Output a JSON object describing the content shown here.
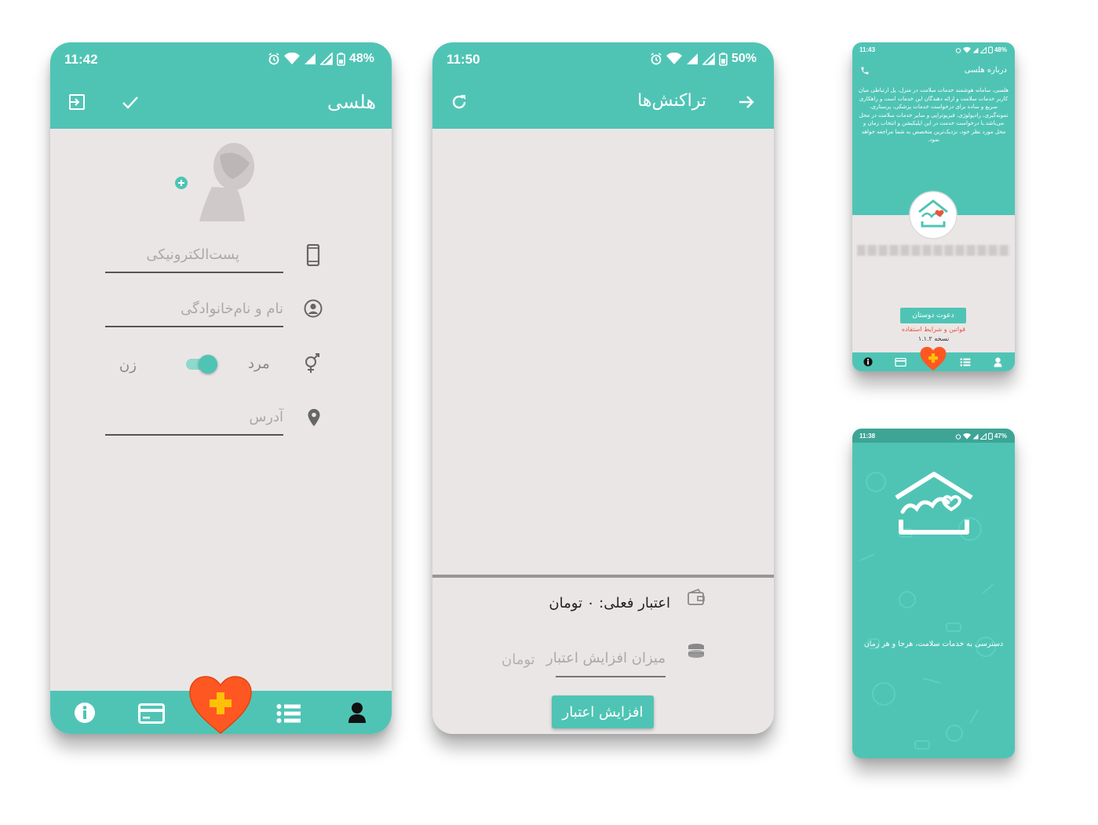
{
  "colors": {
    "primary": "#4fc4b5",
    "primary_dark": "#3ea596",
    "background": "#ebe6e6",
    "heart": "#ff5722",
    "plus": "#ffc107"
  },
  "profile_screen": {
    "status": {
      "time": "11:42",
      "battery": "48%"
    },
    "title": "هلسی",
    "icons": [
      "exit-icon",
      "check-icon"
    ],
    "email_placeholder": "پست‌الکترونیکی",
    "name_placeholder": "نام و نام‌خانوادگی",
    "gender_male": "مرد",
    "gender_female": "زن",
    "address_placeholder": "آدرس"
  },
  "transactions_screen": {
    "status": {
      "time": "11:50",
      "battery": "50%"
    },
    "title": "تراکنش‌ها",
    "current_credit": "اعتبار فعلی: ۰ تومان",
    "amount_placeholder": "میزان افزایش اعتبار",
    "currency": "تومان",
    "increase_button": "افزایش اعتبار"
  },
  "about_screen": {
    "status": {
      "time": "11:43",
      "battery": "48%"
    },
    "title": "درباره هلسی",
    "description": "هلسی، سامانه هوشمند خدمات سلامت در منزل، پل ارتباطی میان کاربر خدمات سلامت و ارائه دهندگان این خدمات است و راهکاری سریع و ساده برای درخواست خدمات پزشکی، پرستاری، نمونه‌گیری، رادیولوژی، فیزیوتراپی و سایر خدمات سلامت در محل می‌باشد.با درخواست خدمت در این اپلیکیشن و انتخاب زمان و محل مورد نظر خود، نزدیک‌ترین متخصص به شما مراجعه خواهد نمود.",
    "invite_button": "دعوت دوستان",
    "terms_link": "قوانین و شرایط استفاده",
    "version": "نسخه ۱.۱.۲"
  },
  "splash_screen": {
    "status": {
      "time": "11:38",
      "battery": "47%"
    },
    "tagline": "دسترسی به خدمات سلامت، هرجا و هر زمان"
  }
}
